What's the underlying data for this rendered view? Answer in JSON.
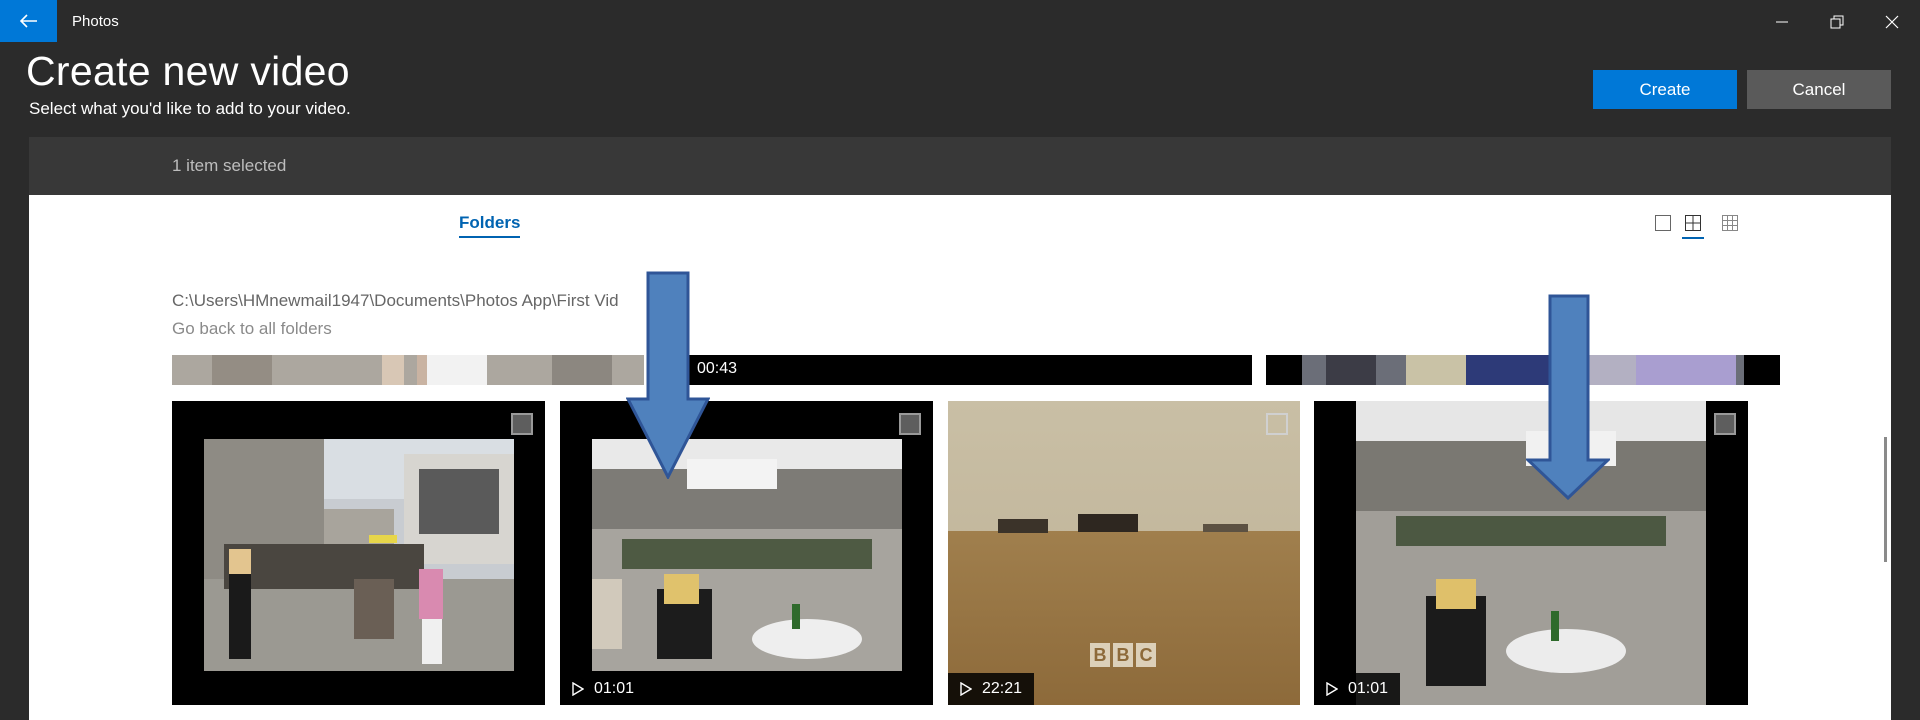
{
  "window": {
    "app_title": "Photos",
    "controls": [
      "minimize",
      "restore",
      "close"
    ]
  },
  "header": {
    "title": "Create new video",
    "subtitle": "Select what you'd like to add to your video.",
    "create_label": "Create",
    "cancel_label": "Cancel"
  },
  "selection": {
    "status": "1 item selected"
  },
  "content": {
    "tab_label": "Folders",
    "path": "C:\\Users\\HMnewmail1947\\Documents\\Photos App\\First Vid",
    "back_link": "Go back to all folders",
    "partial_row": {
      "duration": "00:43"
    },
    "thumbnails": [
      {
        "kind": "photo",
        "subject": "piazza-crowd"
      },
      {
        "kind": "video",
        "duration": "01:01",
        "subject": "cafe-terrace"
      },
      {
        "kind": "video",
        "duration": "22:21",
        "subject": "wheat-field",
        "watermark": "BBC"
      },
      {
        "kind": "video",
        "duration": "01:01",
        "subject": "cafe-terrace"
      }
    ]
  },
  "colors": {
    "accent": "#0078d7",
    "link": "#0063b1",
    "annotation_arrow": "#4f81bd"
  },
  "icons": {
    "back": "back-arrow-icon",
    "view_large": "view-large-icon",
    "view_medium": "view-medium-icon",
    "view_small": "view-small-icon",
    "play": "play-icon"
  }
}
